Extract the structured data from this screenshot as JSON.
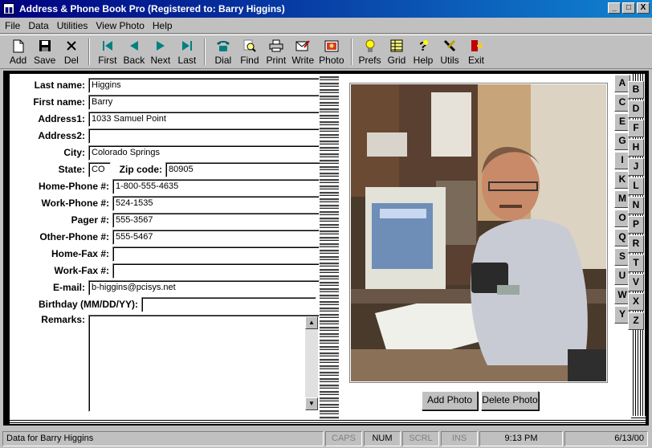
{
  "window": {
    "title": "Address & Phone Book Pro   (Registered to: Barry Higgins)",
    "app_icon": "book-icon",
    "controls": [
      "_",
      "□",
      "X"
    ]
  },
  "menu": [
    "File",
    "Data",
    "Utilities",
    "View Photo",
    "Help"
  ],
  "toolbar": {
    "add": "Add",
    "save": "Save",
    "del": "Del",
    "first": "First",
    "back": "Back",
    "next": "Next",
    "last": "Last",
    "dial": "Dial",
    "find": "Find",
    "print": "Print",
    "write": "Write",
    "photo": "Photo",
    "prefs": "Prefs",
    "grid": "Grid",
    "help": "Help",
    "utils": "Utils",
    "exit": "Exit"
  },
  "form": {
    "last_name_label": "Last name:",
    "last_name": "Higgins",
    "first_name_label": "First name:",
    "first_name": "Barry",
    "address1_label": "Address1:",
    "address1": "1033 Samuel Point",
    "address2_label": "Address2:",
    "address2": "",
    "city_label": "City:",
    "city": "Colorado Springs",
    "state_label": "State:",
    "state": "CO",
    "zip_label": "Zip code:",
    "zip": "80905",
    "home_phone_label": "Home-Phone #:",
    "home_phone": "1-800-555-4635",
    "work_phone_label": "Work-Phone #:",
    "work_phone": "524-1535",
    "pager_label": "Pager #:",
    "pager": "555-3567",
    "other_phone_label": "Other-Phone #:",
    "other_phone": "555-5467",
    "home_fax_label": "Home-Fax #:",
    "home_fax": "",
    "work_fax_label": "Work-Fax #:",
    "work_fax": "",
    "email_label": "E-mail:",
    "email": "b-higgins@pcisys.net",
    "birthday_label": "Birthday (MM/DD/YY):",
    "birthday": "",
    "remarks_label": "Remarks:",
    "remarks": ""
  },
  "photo_buttons": {
    "add": "Add Photo",
    "delete": "Delete Photo"
  },
  "tabs_left": [
    "A",
    "C",
    "E",
    "G",
    "I",
    "K",
    "M",
    "O",
    "Q",
    "S",
    "U",
    "W",
    "Y"
  ],
  "tabs_right": [
    "B",
    "D",
    "F",
    "H",
    "J",
    "L",
    "N",
    "P",
    "R",
    "T",
    "V",
    "X",
    "Z"
  ],
  "status": {
    "message": "Data for Barry Higgins",
    "caps": "CAPS",
    "num": "NUM",
    "scrl": "SCRL",
    "ins": "INS",
    "time": "9:13 PM",
    "date": "6/13/00"
  }
}
